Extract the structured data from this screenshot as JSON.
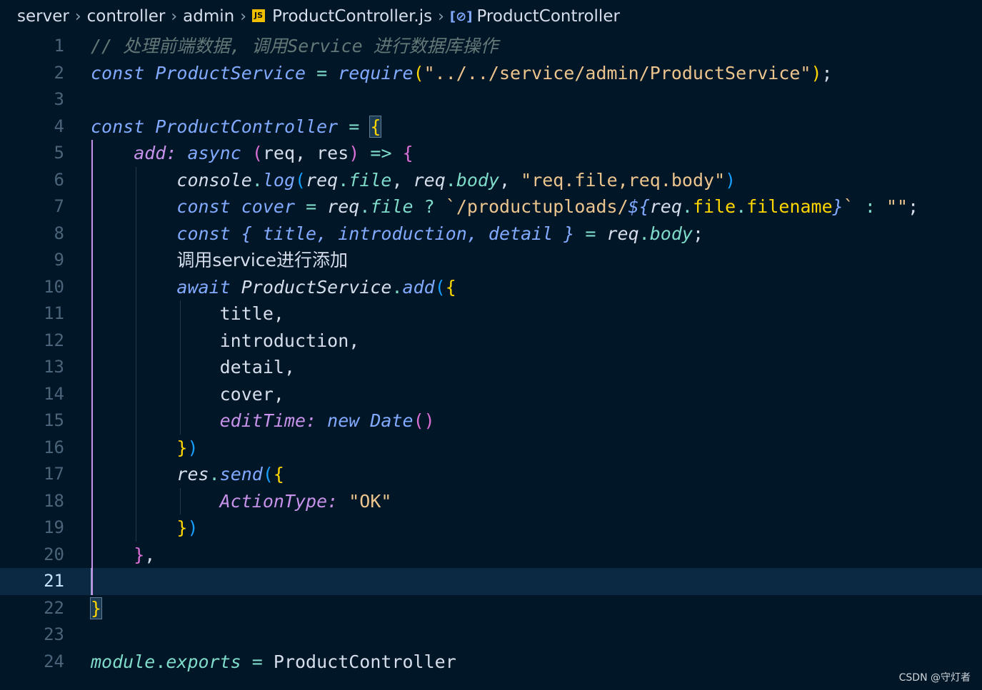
{
  "breadcrumb": {
    "items": [
      "server",
      "controller",
      "admin"
    ],
    "file_icon": "js-file-icon",
    "file": "ProductController.js",
    "symbol_icon": "symbol-variable-icon",
    "symbol": "ProductController"
  },
  "editor": {
    "current_line": 21,
    "line_numbers": [
      "1",
      "2",
      "3",
      "4",
      "5",
      "6",
      "7",
      "8",
      "9",
      "10",
      "11",
      "12",
      "13",
      "14",
      "15",
      "16",
      "17",
      "18",
      "19",
      "20",
      "21",
      "22",
      "23",
      "24"
    ],
    "lines": [
      [
        {
          "t": "// 处理前端数据, 调用Service 进行数据库操作",
          "c": "cm"
        }
      ],
      [
        {
          "t": "const",
          "c": "kw"
        },
        {
          "t": " ",
          "c": "plain"
        },
        {
          "t": "ProductService",
          "c": "vr"
        },
        {
          "t": " = ",
          "c": "op"
        },
        {
          "t": "require",
          "c": "fn"
        },
        {
          "t": "(",
          "c": "b1"
        },
        {
          "t": "\"../../service/admin/ProductService\"",
          "c": "str"
        },
        {
          "t": ")",
          "c": "b1"
        },
        {
          "t": ";",
          "c": "plain"
        }
      ],
      [],
      [
        {
          "t": "const",
          "c": "kw"
        },
        {
          "t": " ",
          "c": "plain"
        },
        {
          "t": "ProductController",
          "c": "vr"
        },
        {
          "t": " = ",
          "c": "op"
        },
        {
          "t": "{",
          "c": "b1 bm"
        }
      ],
      [
        {
          "t": "    ",
          "c": "plain"
        },
        {
          "t": "add",
          "c": "prop"
        },
        {
          "t": ": ",
          "c": "prop"
        },
        {
          "t": "async",
          "c": "kw"
        },
        {
          "t": " ",
          "c": "plain"
        },
        {
          "t": "(",
          "c": "b2"
        },
        {
          "t": "req, res",
          "c": "plain"
        },
        {
          "t": ")",
          "c": "b2"
        },
        {
          "t": " => ",
          "c": "op"
        },
        {
          "t": "{",
          "c": "b2"
        }
      ],
      [
        {
          "t": "        ",
          "c": "plain"
        },
        {
          "t": "console",
          "c": "ital"
        },
        {
          "t": ".",
          "c": "op"
        },
        {
          "t": "log",
          "c": "fn"
        },
        {
          "t": "(",
          "c": "b3"
        },
        {
          "t": "req",
          "c": "ital"
        },
        {
          "t": ".",
          "c": "op"
        },
        {
          "t": "file",
          "c": "prop2"
        },
        {
          "t": ", ",
          "c": "plain"
        },
        {
          "t": "req",
          "c": "ital"
        },
        {
          "t": ".",
          "c": "op"
        },
        {
          "t": "body",
          "c": "prop2"
        },
        {
          "t": ", ",
          "c": "plain"
        },
        {
          "t": "\"req.file,req.body\"",
          "c": "str"
        },
        {
          "t": ")",
          "c": "b3"
        }
      ],
      [
        {
          "t": "        ",
          "c": "plain"
        },
        {
          "t": "const",
          "c": "kw"
        },
        {
          "t": " ",
          "c": "plain"
        },
        {
          "t": "cover",
          "c": "vr"
        },
        {
          "t": " = ",
          "c": "op"
        },
        {
          "t": "req",
          "c": "ital"
        },
        {
          "t": ".",
          "c": "op"
        },
        {
          "t": "file",
          "c": "prop2"
        },
        {
          "t": " ? ",
          "c": "op"
        },
        {
          "t": "`/productuploads/",
          "c": "str"
        },
        {
          "t": "${",
          "c": "kw"
        },
        {
          "t": "req",
          "c": "ital"
        },
        {
          "t": ".",
          "c": "op"
        },
        {
          "t": "file",
          "c": "b1"
        },
        {
          "t": ".",
          "c": "op"
        },
        {
          "t": "filename",
          "c": "b1"
        },
        {
          "t": "}",
          "c": "kw"
        },
        {
          "t": "`",
          "c": "str"
        },
        {
          "t": " : ",
          "c": "op"
        },
        {
          "t": "\"\"",
          "c": "str"
        },
        {
          "t": ";",
          "c": "plain"
        }
      ],
      [
        {
          "t": "        ",
          "c": "plain"
        },
        {
          "t": "const",
          "c": "kw"
        },
        {
          "t": " ",
          "c": "plain"
        },
        {
          "t": "{ title, introduction, detail }",
          "c": "vr"
        },
        {
          "t": " = ",
          "c": "op"
        },
        {
          "t": "req",
          "c": "ital"
        },
        {
          "t": ".",
          "c": "op"
        },
        {
          "t": "body",
          "c": "prop2"
        },
        {
          "t": ";",
          "c": "plain"
        }
      ],
      [
        {
          "t": "        ",
          "c": "plain"
        },
        {
          "t": "调用service进行添加",
          "c": "plain cn"
        }
      ],
      [
        {
          "t": "        ",
          "c": "plain"
        },
        {
          "t": "await",
          "c": "kw"
        },
        {
          "t": " ",
          "c": "plain"
        },
        {
          "t": "ProductService",
          "c": "ital"
        },
        {
          "t": ".",
          "c": "op"
        },
        {
          "t": "add",
          "c": "fn"
        },
        {
          "t": "(",
          "c": "b3"
        },
        {
          "t": "{",
          "c": "b1"
        }
      ],
      [
        {
          "t": "            ",
          "c": "plain"
        },
        {
          "t": "title",
          "c": "plain"
        },
        {
          "t": ",",
          "c": "plain"
        }
      ],
      [
        {
          "t": "            ",
          "c": "plain"
        },
        {
          "t": "introduction",
          "c": "plain"
        },
        {
          "t": ",",
          "c": "plain"
        }
      ],
      [
        {
          "t": "            ",
          "c": "plain"
        },
        {
          "t": "detail",
          "c": "plain"
        },
        {
          "t": ",",
          "c": "plain"
        }
      ],
      [
        {
          "t": "            ",
          "c": "plain"
        },
        {
          "t": "cover",
          "c": "plain"
        },
        {
          "t": ",",
          "c": "plain"
        }
      ],
      [
        {
          "t": "            ",
          "c": "plain"
        },
        {
          "t": "editTime",
          "c": "prop"
        },
        {
          "t": ": ",
          "c": "prop"
        },
        {
          "t": "new",
          "c": "kw"
        },
        {
          "t": " ",
          "c": "plain"
        },
        {
          "t": "Date",
          "c": "fn"
        },
        {
          "t": "()",
          "c": "b2"
        }
      ],
      [
        {
          "t": "        ",
          "c": "plain"
        },
        {
          "t": "}",
          "c": "b1"
        },
        {
          "t": ")",
          "c": "b3"
        }
      ],
      [
        {
          "t": "        ",
          "c": "plain"
        },
        {
          "t": "res",
          "c": "ital"
        },
        {
          "t": ".",
          "c": "op"
        },
        {
          "t": "send",
          "c": "fn"
        },
        {
          "t": "(",
          "c": "b3"
        },
        {
          "t": "{",
          "c": "b1"
        }
      ],
      [
        {
          "t": "            ",
          "c": "plain"
        },
        {
          "t": "ActionType",
          "c": "prop"
        },
        {
          "t": ": ",
          "c": "prop"
        },
        {
          "t": "\"OK\"",
          "c": "str"
        }
      ],
      [
        {
          "t": "        ",
          "c": "plain"
        },
        {
          "t": "}",
          "c": "b1"
        },
        {
          "t": ")",
          "c": "b3"
        }
      ],
      [
        {
          "t": "    ",
          "c": "plain"
        },
        {
          "t": "}",
          "c": "b2"
        },
        {
          "t": ",",
          "c": "plain"
        }
      ],
      [],
      [
        {
          "t": "}",
          "c": "b1 bm"
        }
      ],
      [],
      [
        {
          "t": "module",
          "c": "prop2"
        },
        {
          "t": ".",
          "c": "op"
        },
        {
          "t": "exports",
          "c": "prop2"
        },
        {
          "t": " = ",
          "c": "op"
        },
        {
          "t": "ProductController",
          "c": "plain"
        }
      ]
    ]
  },
  "watermark": "CSDN @守灯者",
  "colors": {
    "background": "#011627",
    "current_line": "#0b2942",
    "keyword": "#82aaff",
    "string": "#ecc48d",
    "comment": "#637777",
    "property": "#c792ea",
    "operator": "#7fdbca"
  }
}
